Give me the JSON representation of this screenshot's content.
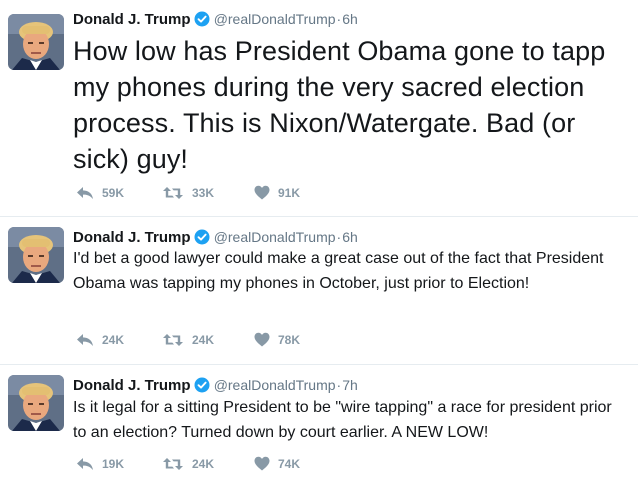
{
  "colors": {
    "verified": "#1da1f2",
    "meta": "#657786",
    "action": "#8899a6",
    "divider": "#e6ecf0"
  },
  "tweets": [
    {
      "name": "Donald J. Trump",
      "handle": "@realDonaldTrump",
      "separator": "·",
      "time": "6h",
      "text": "How low has President Obama gone to tapp my phones during the very sacred election process. This is Nixon/Watergate. Bad (or sick) guy!",
      "replies": "59K",
      "retweets": "33K",
      "likes": "91K",
      "icons": [
        "reply-icon",
        "retweet-icon",
        "heart-icon"
      ]
    },
    {
      "name": "Donald J. Trump",
      "handle": "@realDonaldTrump",
      "separator": "·",
      "time": "6h",
      "text": "I'd bet a good lawyer could make a great case out of the fact that President Obama was tapping my phones in October, just prior to Election!",
      "replies": "24K",
      "retweets": "24K",
      "likes": "78K",
      "icons": [
        "reply-icon",
        "retweet-icon",
        "heart-icon"
      ]
    },
    {
      "name": "Donald J. Trump",
      "handle": "@realDonaldTrump",
      "separator": "·",
      "time": "7h",
      "text": "Is it legal for a sitting President to be \"wire tapping\" a race for president prior to an election? Turned down by court earlier. A NEW LOW!",
      "replies": "19K",
      "retweets": "24K",
      "likes": "74K",
      "icons": [
        "reply-icon",
        "retweet-icon",
        "heart-icon"
      ]
    }
  ]
}
